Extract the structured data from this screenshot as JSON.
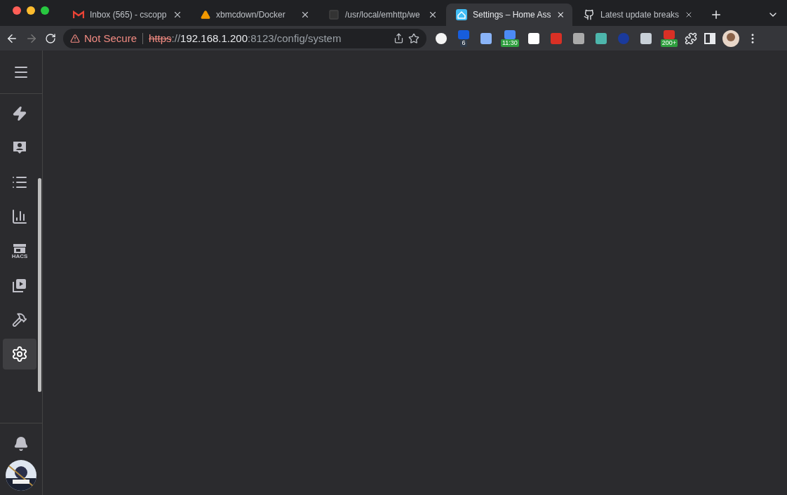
{
  "tabs": [
    {
      "kind": "gmail",
      "title": "Inbox (565) - cscopp",
      "selected": false
    },
    {
      "kind": "warning",
      "title": "xbmcdown/Docker",
      "selected": false
    },
    {
      "kind": "square",
      "title": "/usr/local/emhttp/we",
      "selected": false
    },
    {
      "kind": "home",
      "title": "Settings – Home Ass",
      "selected": true
    },
    {
      "kind": "github",
      "title": "Latest update breaks",
      "selected": false
    }
  ],
  "address_bar": {
    "security": "Not Secure",
    "scheme": "https",
    "separator": "://",
    "host": "192.168.1.200",
    "path": ":8123/config/system"
  },
  "extensions": [
    {
      "kind": "toggle"
    },
    {
      "kind": "shield",
      "badge": "6"
    },
    {
      "kind": "window"
    },
    {
      "kind": "calendar",
      "badge": "11:30"
    },
    {
      "kind": "qr"
    },
    {
      "kind": "hand"
    },
    {
      "kind": "k"
    },
    {
      "kind": "sync"
    },
    {
      "kind": "ring"
    },
    {
      "kind": "spy"
    },
    {
      "kind": "alert",
      "badge": "200+"
    }
  ],
  "sidebar": {
    "items": [
      {
        "kind": "energy",
        "selected": false
      },
      {
        "kind": "person",
        "selected": false
      },
      {
        "kind": "list",
        "selected": false
      },
      {
        "kind": "chart",
        "selected": false
      },
      {
        "kind": "store",
        "label": "HACS",
        "selected": false
      },
      {
        "kind": "media",
        "selected": false
      },
      {
        "kind": "hammer",
        "selected": false
      },
      {
        "kind": "settings",
        "selected": true
      }
    ]
  }
}
